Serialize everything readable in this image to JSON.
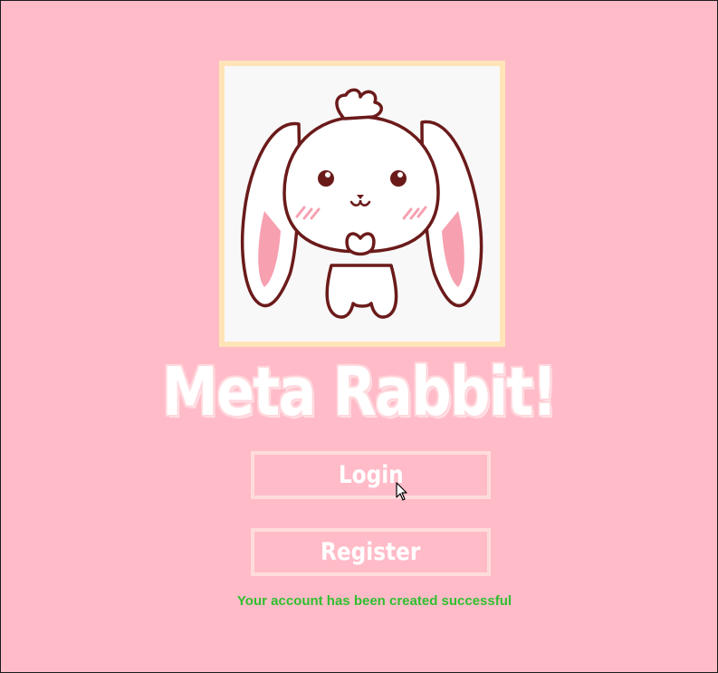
{
  "app": {
    "title": "Meta Rabbit!",
    "logo_icon": "rabbit-mascot-icon"
  },
  "buttons": {
    "login_label": "Login",
    "register_label": "Register"
  },
  "status": {
    "message": "Your account has been created successful",
    "color": "#2fbf2f"
  },
  "colors": {
    "background": "#ffbcc8",
    "logo_border": "#ffe4b8",
    "button_border": "#ffdcdc",
    "text": "#ffffff"
  }
}
